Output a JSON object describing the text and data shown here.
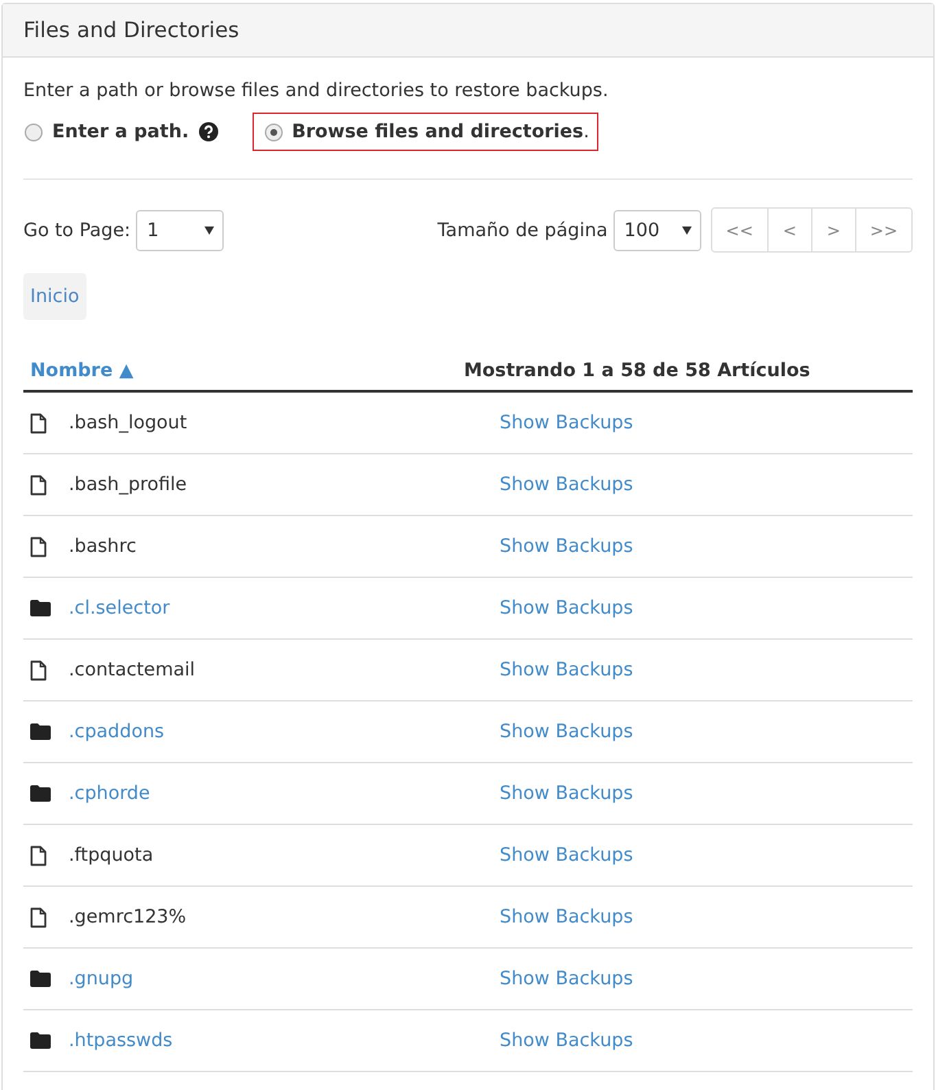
{
  "panel": {
    "title": "Files and Directories"
  },
  "intro": "Enter a path or browse files and directories to restore backups.",
  "options": [
    {
      "label": "**Enter a path.**",
      "selected": false,
      "help": true
    },
    {
      "label": "**Browse files and directories**.",
      "selected": true,
      "help": false
    }
  ],
  "pager": {
    "goto_label": "Go to Page:",
    "page": "1",
    "size_label": "Tamaño de página",
    "size": "100",
    "buttons": [
      "<<",
      "<",
      ">",
      ">>"
    ]
  },
  "breadcrumb": "Inicio",
  "table": {
    "columns": [
      {
        "label": "Nombre ▲",
        "sortable": true
      },
      {
        "label": "Mostrando 1 a 58 de 58 Artículos",
        "sortable": false
      }
    ],
    "rows": [
      {
        "kind": "file",
        "name": ".bash_logout",
        "action": "Show Backups"
      },
      {
        "kind": "file",
        "name": ".bash_profile",
        "action": "Show Backups"
      },
      {
        "kind": "file",
        "name": ".bashrc",
        "action": "Show Backups"
      },
      {
        "kind": "folder",
        "name": ".cl.selector",
        "action": "Show Backups"
      },
      {
        "kind": "file",
        "name": ".contactemail",
        "action": "Show Backups"
      },
      {
        "kind": "folder",
        "name": ".cpaddons",
        "action": "Show Backups"
      },
      {
        "kind": "folder",
        "name": ".cphorde",
        "action": "Show Backups"
      },
      {
        "kind": "file",
        "name": ".ftpquota",
        "action": "Show Backups"
      },
      {
        "kind": "file",
        "name": ".gemrc123%",
        "action": "Show Backups"
      },
      {
        "kind": "folder",
        "name": ".gnupg",
        "action": "Show Backups"
      },
      {
        "kind": "folder",
        "name": ".htpasswds",
        "action": "Show Backups"
      }
    ]
  }
}
